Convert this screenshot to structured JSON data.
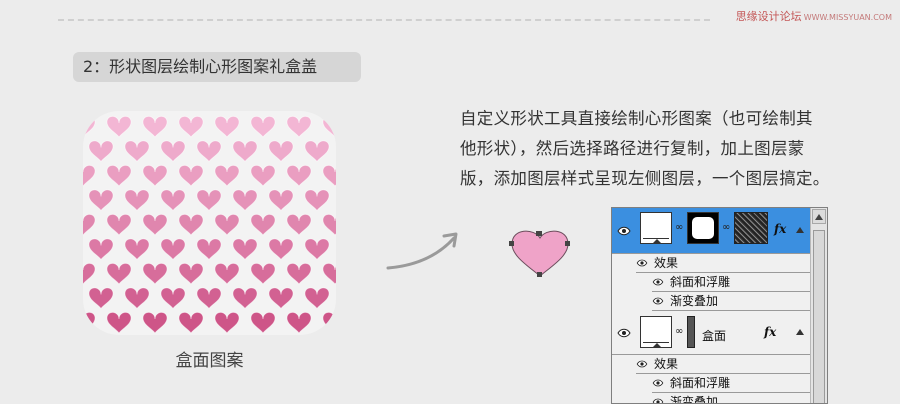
{
  "watermark": {
    "text": "思缘设计论坛",
    "url": "WWW.MISSYUAN.COM"
  },
  "step": {
    "label": "2：形状图层绘制心形图案礼盒盖"
  },
  "pattern": {
    "caption": "盒面图案",
    "colors": {
      "top": "#f3b6d4",
      "bottom": "#c9497f",
      "background": "#f3f3f3"
    }
  },
  "description": {
    "line1": "自定义形状工具直接绘制心形图案（也可绘制其",
    "line2": "他形状），然后选择路径进行复制，加上图层蒙",
    "line3": "版，添加图层样式呈现左侧图层，一个图层搞定。"
  },
  "heart_shape": {
    "fill": "#efa3c8",
    "stroke": "#6b4d5c"
  },
  "layers_panel": {
    "layer1": {
      "fx": "fx",
      "effects_label": "效果",
      "effect1": "斜面和浮雕",
      "effect2": "渐变叠加"
    },
    "layer2": {
      "name": "盒面",
      "fx": "fx",
      "effects_label": "效果",
      "effect1": "斜面和浮雕",
      "effect2": "渐变叠加"
    },
    "selected_color": "#3b8fe0"
  }
}
